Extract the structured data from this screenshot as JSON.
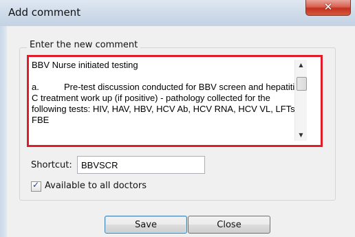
{
  "window": {
    "title": "Add comment",
    "close_glyph": "✕"
  },
  "group": {
    "label": "Enter the new comment"
  },
  "comment": {
    "text": "BBV Nurse initiated testing\n\na.          Pre-test discussion conducted for BBV screen and hepatitis C treatment work up (if positive) - pathology collected for the following tests: HIV, HAV, HBV, HCV Ab, HCV RNA, HCV VL, LFTs, FBE"
  },
  "shortcut": {
    "label": "Shortcut:",
    "value": "BBVSCR"
  },
  "available": {
    "label": "Available to all doctors",
    "checked": true
  },
  "buttons": {
    "save": "Save",
    "close": "Close"
  },
  "colors": {
    "highlight_frame": "#e11b28",
    "titlebar": "#cfdbe9"
  },
  "icons": {
    "close": "close-icon",
    "scroll_up": "scroll-up-arrow",
    "scroll_down": "scroll-down-arrow",
    "check": "checkmark-icon"
  }
}
